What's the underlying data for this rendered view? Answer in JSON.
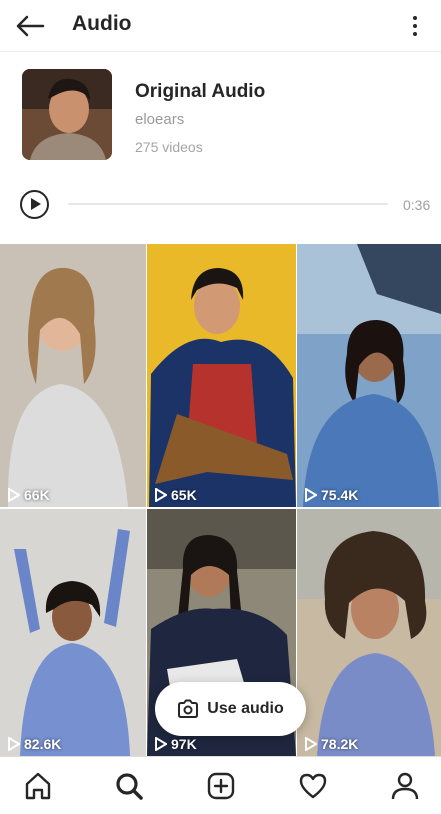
{
  "header": {
    "title": "Audio",
    "back_icon": "arrow-left-icon",
    "menu_icon": "more-vertical-icon"
  },
  "audio": {
    "title": "Original Audio",
    "artist": "eloears",
    "video_count": "275 videos"
  },
  "player": {
    "duration": "0:36",
    "progress": 0
  },
  "videos": [
    {
      "views": "66K",
      "bg": "#c9c0b6"
    },
    {
      "views": "65K",
      "bg": "#e9b92a"
    },
    {
      "views": "75.4K",
      "bg": "#7ea2c8"
    },
    {
      "views": "82.6K",
      "bg": "#d8d6d2"
    },
    {
      "views": "97K",
      "bg": "#8e8878"
    },
    {
      "views": "78.2K",
      "bg": "#c7b9a2"
    }
  ],
  "cta": {
    "label": "Use audio",
    "icon": "camera-icon"
  },
  "nav": [
    "home-icon",
    "search-icon",
    "add-post-icon",
    "heart-icon",
    "profile-icon"
  ],
  "colors": {
    "text": "#262626",
    "secondary": "#9a9a9a",
    "divider": "#ececec"
  }
}
